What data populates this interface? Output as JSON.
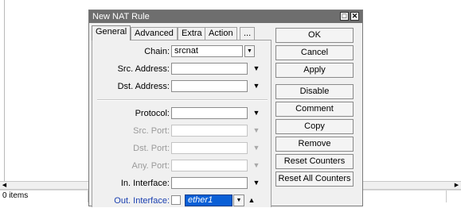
{
  "background": {
    "status_text": "0 items"
  },
  "dialog": {
    "title": "New NAT Rule",
    "title_buttons": [
      "restore",
      "close"
    ],
    "tabs": [
      "General",
      "Advanced",
      "Extra",
      "Action",
      "..."
    ],
    "active_tab": "General",
    "fields": {
      "chain": {
        "label": "Chain:",
        "value": "srcnat"
      },
      "src_address": {
        "label": "Src. Address:",
        "value": ""
      },
      "dst_address": {
        "label": "Dst. Address:",
        "value": ""
      },
      "protocol": {
        "label": "Protocol:",
        "value": ""
      },
      "src_port": {
        "label": "Src. Port:",
        "value": ""
      },
      "dst_port": {
        "label": "Dst. Port:",
        "value": ""
      },
      "any_port": {
        "label": "Any. Port:",
        "value": ""
      },
      "in_interface": {
        "label": "In. Interface:",
        "value": ""
      },
      "out_interface": {
        "label": "Out. Interface:",
        "value": "ether1"
      }
    },
    "buttons": [
      "OK",
      "Cancel",
      "Apply",
      "Disable",
      "Comment",
      "Copy",
      "Remove",
      "Reset Counters",
      "Reset All Counters"
    ]
  }
}
